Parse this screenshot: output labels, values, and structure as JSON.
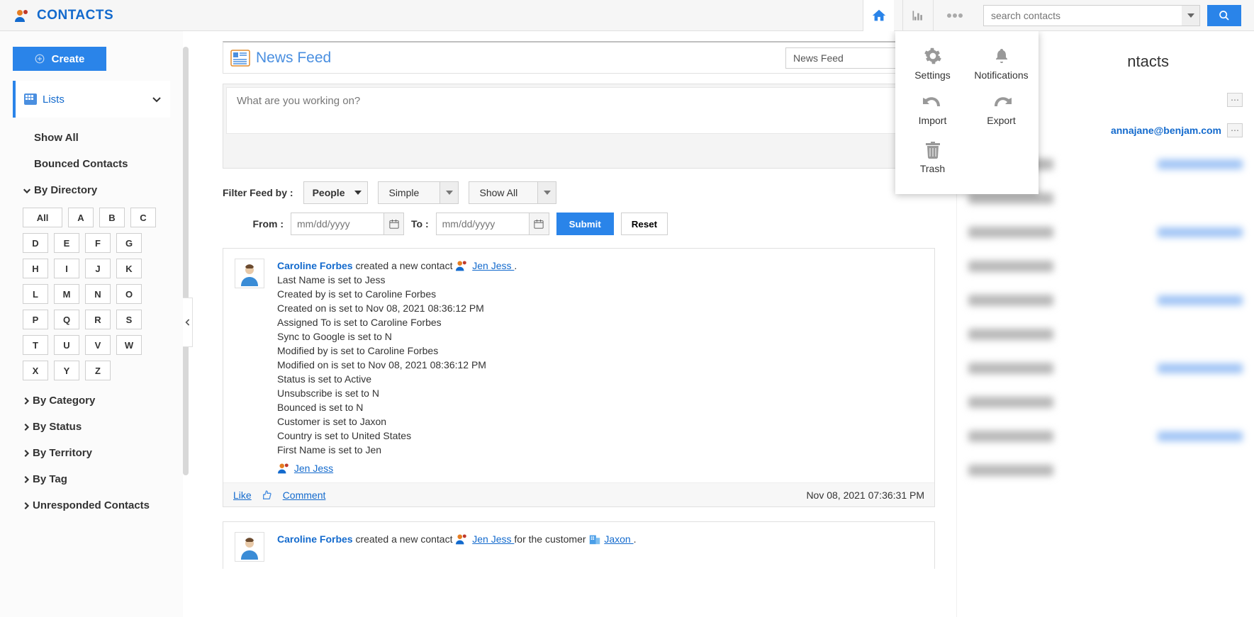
{
  "brand": {
    "title": "CONTACTS"
  },
  "search": {
    "placeholder": "search contacts"
  },
  "sidebar": {
    "create": "Create",
    "lists_label": "Lists",
    "show_all": "Show All",
    "bounced": "Bounced Contacts",
    "by_directory": "By Directory",
    "letters_all": "All",
    "letters": [
      "A",
      "B",
      "C",
      "D",
      "E",
      "F",
      "G",
      "H",
      "I",
      "J",
      "K",
      "L",
      "M",
      "N",
      "O",
      "P",
      "Q",
      "R",
      "S",
      "T",
      "U",
      "V",
      "W",
      "X",
      "Y",
      "Z"
    ],
    "by_category": "By Category",
    "by_status": "By Status",
    "by_territory": "By Territory",
    "by_tag": "By Tag",
    "unresponded": "Unresponded Contacts"
  },
  "feed": {
    "title": "News Feed",
    "tab_pill": "News Feed",
    "composer_placeholder": "What are you working on?",
    "filter_label": "Filter Feed by :",
    "people_btn": "People",
    "simple_btn": "Simple",
    "show_all_btn": "Show All",
    "from_label": "From :",
    "to_label": "To :",
    "date_placeholder": "mm/dd/yyyy",
    "submit": "Submit",
    "reset": "Reset"
  },
  "item1": {
    "author": "Caroline Forbes",
    "verb": " created a new contact ",
    "link": " Jen Jess ",
    "lines": [
      "Last Name is set to Jess",
      "Created by is set to Caroline Forbes",
      "Created on is set to Nov 08, 2021 08:36:12 PM",
      "Assigned To is set to Caroline Forbes",
      "Sync to Google is set to N",
      "Modified by is set to Caroline Forbes",
      "Modified on is set to Nov 08, 2021 08:36:12 PM",
      "Status is set to Active",
      "Unsubscribe is set to N",
      "Bounced is set to N",
      "Customer is set to Jaxon",
      "Country is set to United States",
      "First Name is set to Jen"
    ],
    "mention": "Jen Jess",
    "like": "Like",
    "comment": "Comment",
    "timestamp": "Nov 08, 2021 07:36:31 PM"
  },
  "item2": {
    "author": "Caroline Forbes",
    "verb": " created a new contact ",
    "link": " Jen Jess ",
    "verb2": "for the customer ",
    "customer_link": " Jaxon "
  },
  "right": {
    "title_suffix": "ntacts",
    "email_visible": "annajane@benjam.com"
  },
  "dropdown": {
    "settings": "Settings",
    "notifications": "Notifications",
    "import": "Import",
    "export": "Export",
    "trash": "Trash"
  }
}
